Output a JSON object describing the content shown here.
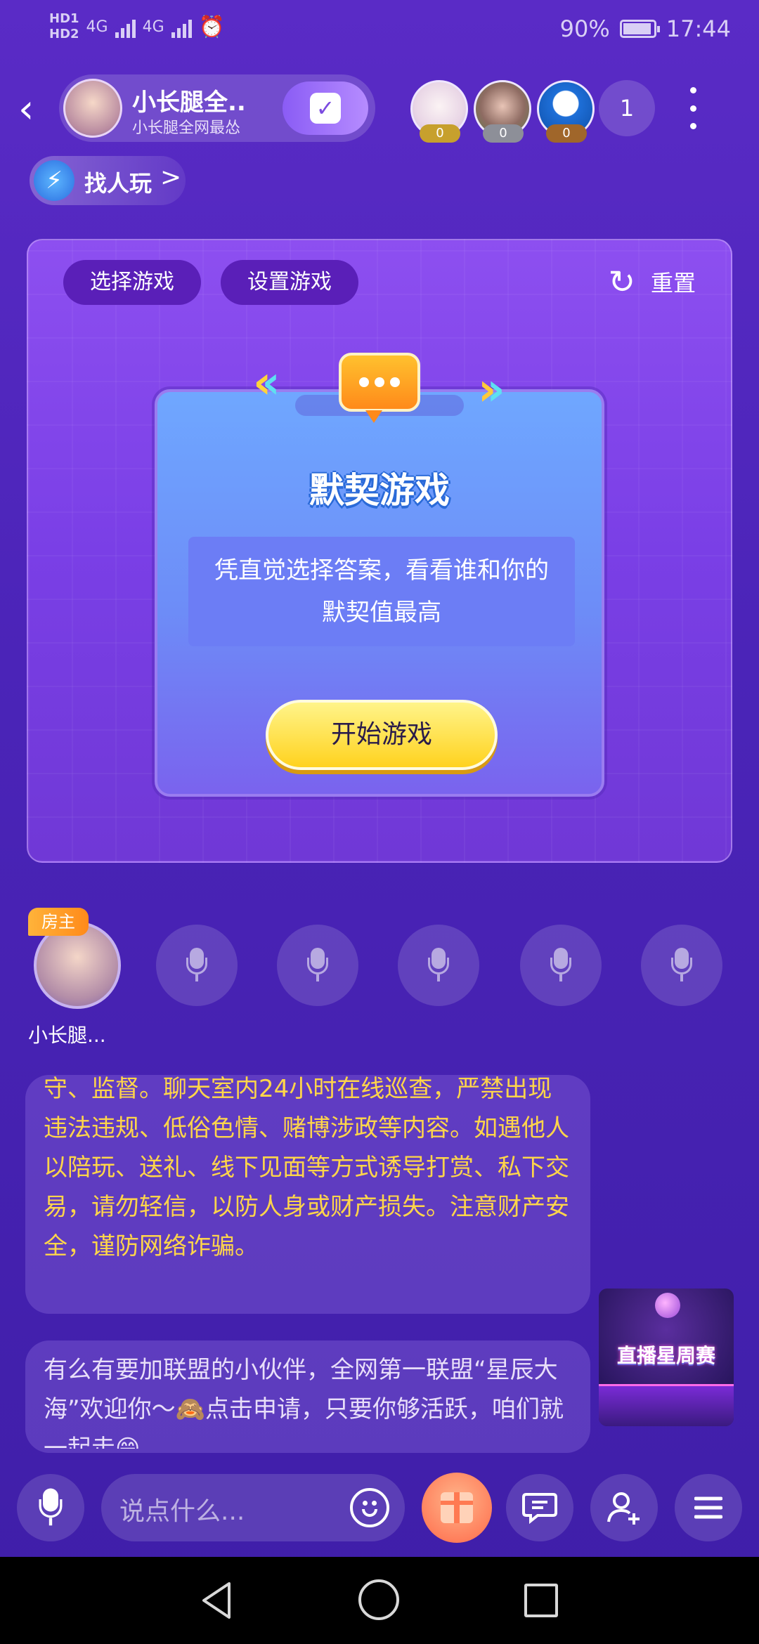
{
  "status_bar": {
    "hd1": "HD1",
    "hd2": "HD2",
    "net1": "4G",
    "net2": "4G",
    "battery": "90%",
    "battery_level": 0.9,
    "time": "17:44"
  },
  "header": {
    "back_icon": "chevron-left-icon",
    "room_title": "小长腿全...",
    "room_subtitle": "小长腿全网最怂",
    "check_icon": "check-square-icon",
    "viewers": [
      {
        "count": "0"
      },
      {
        "count": "0"
      },
      {
        "count": "0"
      }
    ],
    "viewer_total": "1",
    "more_icon": "more-vertical-icon"
  },
  "find_play": {
    "label": "找人玩",
    "chevron": ">"
  },
  "game_panel": {
    "select_game": "选择游戏",
    "set_game": "设置游戏",
    "reset_label": "重置",
    "reset_icon": "↻",
    "card": {
      "title": "默契游戏",
      "description": "凭直觉选择答案，看看谁和你的默契值最高",
      "start_button": "开始游戏"
    }
  },
  "seats": {
    "host_badge": "房主",
    "host_name": "小长腿...",
    "empty_seat_icon": "microphone-icon",
    "empty_count": 5
  },
  "chat": {
    "notice": "守、监督。聊天室内24小时在线巡查，严禁出现违法违规、低俗色情、赌博涉政等内容。如遇他人以陪玩、送礼、线下见面等方式诱导打赏、私下交易，请勿轻信，以防人身或财产损失。注意财产安全，谨防网络诈骗。",
    "message": "有么有要加联盟的小伙伴，全网第一联盟“星辰大海”欢迎你～🙈点击申请，只要你够活跃，咱们就一起走😄"
  },
  "banner": {
    "text": "直播星周赛"
  },
  "bottom_bar": {
    "mic_icon": "microphone-icon",
    "input_placeholder": "说点什么...",
    "emoji_icon": "smile-icon",
    "gift_icon": "gift-icon",
    "message_icon": "chat-bubble-icon",
    "add_user_icon": "add-user-icon",
    "menu_icon": "menu-icon"
  },
  "colors": {
    "background": "#4b24b8",
    "notice_text": "#ffd54a",
    "start_button": "#ffd21e",
    "host_badge": "#ff9a2a"
  }
}
